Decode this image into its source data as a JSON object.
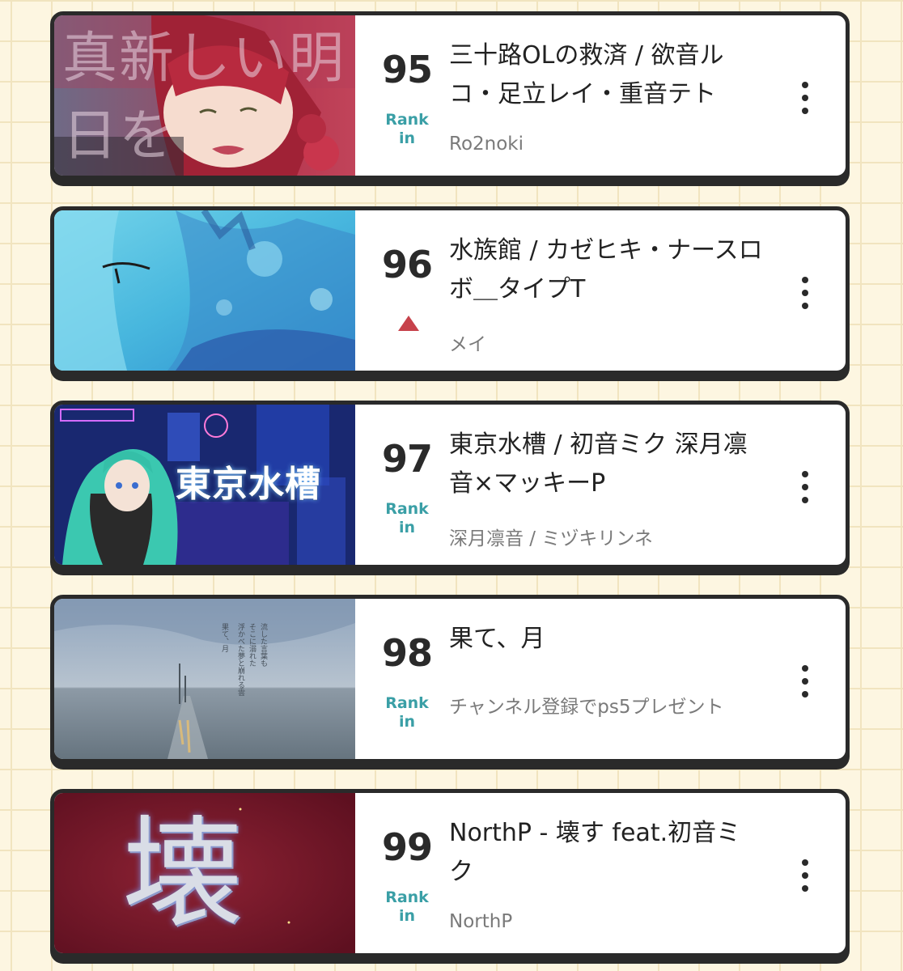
{
  "colors": {
    "background": "#fdf6e1",
    "grid_line": "#f1e4bf",
    "card_border": "#2a2a2a",
    "rank_in_teal": "#3a9fa6",
    "rank_up_red": "#c7424b"
  },
  "items": [
    {
      "rank": "95",
      "status": "rank-in",
      "status_label": "Rank in",
      "title": "三十路OLの救済 / 欲音ルコ・足立レイ・重音テト",
      "artist": "Ro2noki",
      "thumbnail": {
        "text": "真新しい明日を",
        "description_icon": "anime-girl-crying-thumbnail"
      },
      "menu_icon": "more-vertical-icon"
    },
    {
      "rank": "96",
      "status": "up",
      "status_label": "",
      "title": "水族館 / カゼヒキ・ナースロボ＿タイプT",
      "artist": "メイ",
      "thumbnail": {
        "text": "",
        "description_icon": "underwater-face-thumbnail"
      },
      "menu_icon": "more-vertical-icon"
    },
    {
      "rank": "97",
      "status": "rank-in",
      "status_label": "Rank in",
      "title": "東京水槽 / 初音ミク 深月凛音×マッキーP",
      "artist": "深月凛音 / ミヅキリンネ",
      "thumbnail": {
        "text": "東京水槽",
        "description_icon": "neon-city-miku-thumbnail"
      },
      "menu_icon": "more-vertical-icon"
    },
    {
      "rank": "98",
      "status": "rank-in",
      "status_label": "Rank in",
      "title": "果て、月",
      "artist": "チャンネル登録でps5プレゼント",
      "thumbnail": {
        "text": "",
        "description_icon": "sea-horizon-thumbnail"
      },
      "menu_icon": "more-vertical-icon"
    },
    {
      "rank": "99",
      "status": "rank-in",
      "status_label": "Rank in",
      "title": "NorthP - 壊す feat.初音ミク",
      "artist": "NorthP",
      "thumbnail": {
        "text": "壊",
        "description_icon": "kanji-crimson-thumbnail"
      },
      "menu_icon": "more-vertical-icon"
    }
  ]
}
